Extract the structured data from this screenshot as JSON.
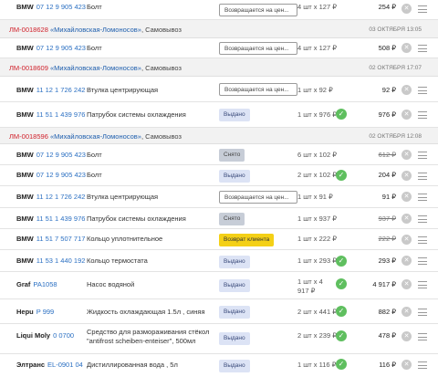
{
  "orders": [
    {
      "id": "ЛМ-0018628",
      "store": "«Михайловская-Ломоносов»",
      "delivery": "Самовывоз",
      "date": "03 октября 13:05"
    },
    {
      "id": "ЛМ-0018609",
      "store": "«Михайловская-Ломоносов»",
      "delivery": "Самовывоз",
      "date": "02 октября 17:07"
    },
    {
      "id": "ЛМ-0018596",
      "store": "«Михайловская-Ломоносов»",
      "delivery": "Самовывоз",
      "date": "02 октября 12:08"
    }
  ],
  "items": [
    {
      "brand": "BMW",
      "article": "07 12 9 905 423",
      "name": "Болт",
      "status": "Возвращается на цен...",
      "qty": "4 шт x 127 ₽",
      "sum": "254 ₽"
    },
    {
      "brand": "BMW",
      "article": "07 12 9 905 423",
      "name": "Болт",
      "status": "Возвращается на цен...",
      "qty": "4 шт x 127 ₽",
      "sum": "508 ₽"
    },
    {
      "brand": "BMW",
      "article": "11 12 1 726 242",
      "name": "Втулка центрирующая",
      "status": "Возвращается на цен...",
      "qty": "1 шт x 92 ₽",
      "sum": "92 ₽"
    },
    {
      "brand": "BMW",
      "article": "11 51 1 439 976",
      "name": "Патрубок системы охлаждения",
      "status": "Выдано",
      "qty": "1 шт x 976 ₽",
      "sum": "976 ₽"
    },
    {
      "brand": "BMW",
      "article": "07 12 9 905 423",
      "name": "Болт",
      "status": "Снято",
      "qty": "6 шт x 102 ₽",
      "sum": "612 ₽"
    },
    {
      "brand": "BMW",
      "article": "07 12 9 905 423",
      "name": "Болт",
      "status": "Выдано",
      "qty": "2 шт x 102 ₽",
      "sum": "204 ₽"
    },
    {
      "brand": "BMW",
      "article": "11 12 1 726 242",
      "name": "Втулка центрирующая",
      "status": "Возвращается на цен...",
      "qty": "1 шт x 91 ₽",
      "sum": "91 ₽"
    },
    {
      "brand": "BMW",
      "article": "11 51 1 439 976",
      "name": "Патрубок системы охлаждения",
      "status": "Снято",
      "qty": "1 шт x 937 ₽",
      "sum": "937 ₽"
    },
    {
      "brand": "BMW",
      "article": "11 51 7 507 717",
      "name": "Кольцо уплотнительное",
      "status": "Возврат клиента",
      "qty": "1 шт x 222 ₽",
      "sum": "222 ₽"
    },
    {
      "brand": "BMW",
      "article": "11 53 1 440 192",
      "name": "Кольцо термостата",
      "status": "Выдано",
      "qty": "1 шт x 293 ₽",
      "sum": "293 ₽"
    },
    {
      "brand": "Graf",
      "article": "PA1058",
      "name": "Насос водяной",
      "status": "Выдано",
      "qty": "1 шт x 4 917 ₽",
      "sum": "4 917 ₽"
    },
    {
      "brand": "Hepu",
      "article": "P 999",
      "name": "Жидкость охлаждающая 1.5л , синяя",
      "status": "Выдано",
      "qty": "2 шт x 441 ₽",
      "sum": "882 ₽"
    },
    {
      "brand": "Liqui Moly",
      "article": "0 0700",
      "name": "Средство для размораживания стёкол \"antifrost scheiben-enteiser\", 500мл",
      "status": "Выдано",
      "qty": "2 шт x 239 ₽",
      "sum": "478 ₽"
    },
    {
      "brand": "Элтранс",
      "article": "EL-0901 04",
      "name": "Дистиллированная вода , 5л",
      "status": "Выдано",
      "qty": "1 шт x 116 ₽",
      "sum": "116 ₽"
    }
  ],
  "icons": {
    "check": "check-icon",
    "remove": "close-icon",
    "menu": "menu-icon"
  },
  "colors": {
    "order_number": "#d0212b",
    "article": "#2a6fc2",
    "issued_badge": "#dce3f5",
    "removed_badge": "#c7cdd7",
    "client_return_badge": "#f4d016",
    "check": "#5fbf5f"
  }
}
